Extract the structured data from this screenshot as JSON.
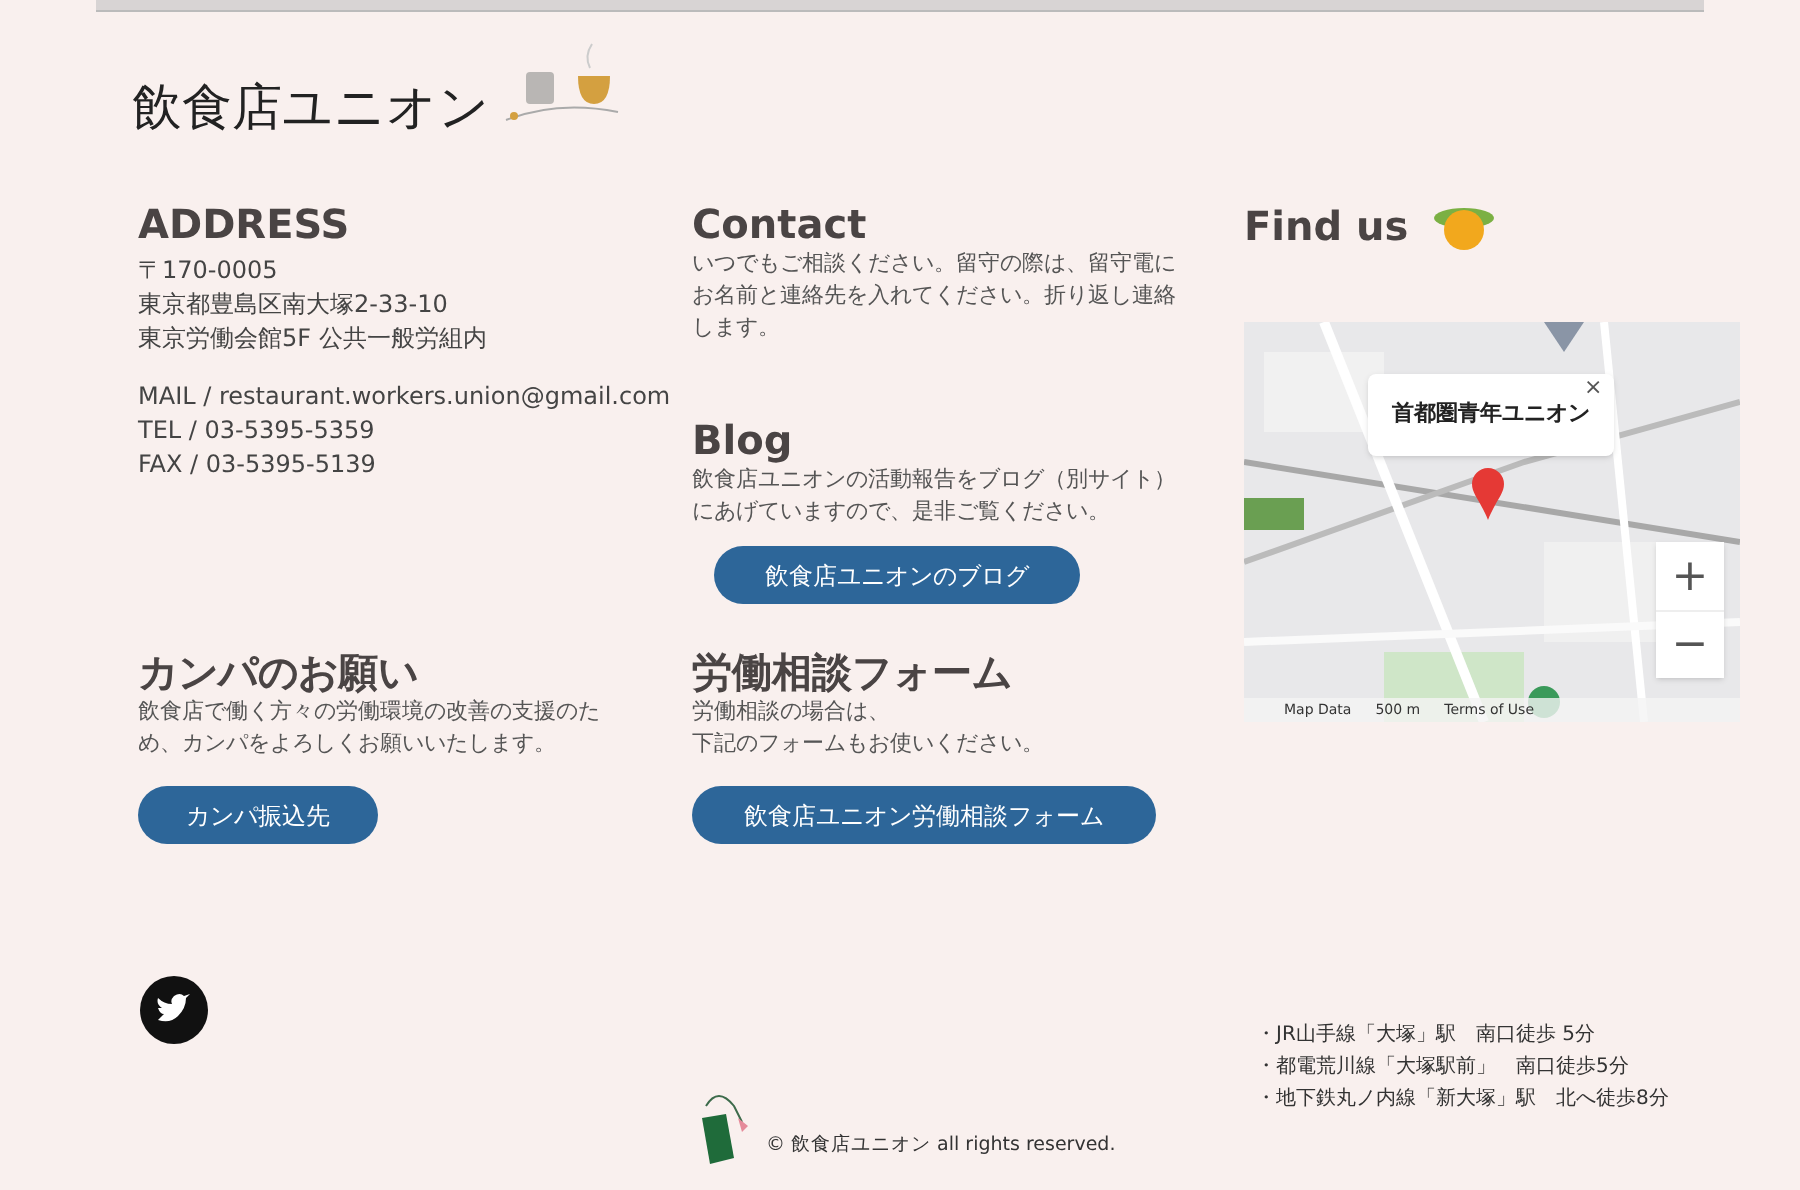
{
  "logo": {
    "title": "飲食店ユニオン"
  },
  "address": {
    "heading": "ADDRESS",
    "lines": [
      "〒170-0005",
      "東京都豊島区南大塚2-33-10",
      "東京労働会館5F 公共一般労組内"
    ],
    "contacts": [
      "MAIL / restaurant.workers.union@gmail.com",
      "TEL / 03-5395-5359",
      "FAX / 03-5395-5139"
    ]
  },
  "contact": {
    "heading": "Contact",
    "text": "いつでもご相談ください。留守の際は、留守電にお名前と連絡先を入れてください。折り返し連絡します。"
  },
  "blog": {
    "heading": "Blog",
    "text": "飲食店ユニオンの活動報告をブログ（別サイト）にあげていますので、是非ご覧ください。",
    "button": "飲食店ユニオンのブログ"
  },
  "find_us": {
    "heading": "Find us",
    "map": {
      "popup": "首都圏青年ユニオン",
      "close": "×",
      "zoom_in": "+",
      "zoom_out": "−",
      "attribution": [
        "Map Data",
        "500 m",
        "Terms of Use"
      ]
    }
  },
  "kanpa": {
    "heading": "カンパのお願い",
    "text": "飲食店で働く方々の労働環境の改善の支援のため、カンパをよろしくお願いいたします。",
    "button": "カンパ振込先"
  },
  "form": {
    "heading": "労働相談フォーム",
    "lines": [
      "労働相談の場合は、",
      "下記のフォームもお使いください。"
    ],
    "button": "飲食店ユニオン労働相談フォーム"
  },
  "footer": {
    "copyright": "© 飲食店ユニオン all rights reserved.",
    "access": [
      "・JR山手線「大塚」駅　南口徒歩 5分",
      "・都電荒川線「大塚駅前」　南口徒歩5分",
      "・地下鉄丸ノ内線「新大塚」駅　北へ徒歩8分"
    ]
  }
}
